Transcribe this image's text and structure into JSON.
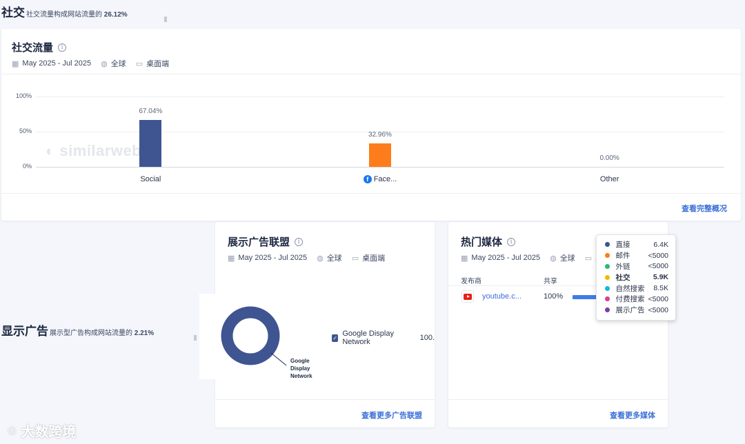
{
  "social_section": {
    "title": "社交",
    "subtitle_prefix": "社交流量构成网站流量的",
    "subtitle_value": "26.12%"
  },
  "social_card": {
    "title": "社交流量",
    "date_range": "May 2025 - Jul 2025",
    "region": "全球",
    "device": "桌面端",
    "watermark": "similarweb",
    "footer_link": "查看完整概况"
  },
  "chart_data": {
    "type": "bar",
    "categories": [
      "Social",
      "Face...",
      "Other"
    ],
    "values": [
      67.04,
      32.96,
      0.0
    ],
    "value_labels": [
      "67.04%",
      "32.96%",
      "0.00%"
    ],
    "colors": [
      "#3f5591",
      "#fd7d1c",
      "#3f5591"
    ],
    "y_ticks": [
      "100%",
      "50%",
      "0%"
    ],
    "ylim": [
      0,
      100
    ],
    "grid": true
  },
  "display_section": {
    "title": "显示广告",
    "subtitle_prefix": "展示型广告构成网站流量的",
    "subtitle_value": "2.21%"
  },
  "ad_card": {
    "title": "展示广告联盟",
    "date_range": "May 2025 - Jul 2025",
    "region": "全球",
    "device": "桌面端",
    "donut_label_lines": [
      "Google",
      "Display",
      "Network"
    ],
    "legend_name": "Google Display Network",
    "legend_value": "100.",
    "donut_color": "#3f5591",
    "share": 100,
    "footer_link": "查看更多广告联盟"
  },
  "media_card": {
    "title": "热门媒体",
    "date_range": "May 2025 - Jul 2025",
    "region": "全球",
    "device_partial": "桌",
    "col_publisher": "发布商",
    "col_share": "共享",
    "row_site": "youtube.c...",
    "row_share": "100%",
    "share_fraction": 0.45,
    "footer_link": "查看更多媒体"
  },
  "tooltip": {
    "items": [
      {
        "name": "直接",
        "value": "6.4K",
        "color": "#3f5591",
        "active": false
      },
      {
        "name": "邮件",
        "value": "<5000",
        "color": "#fd7d1c",
        "active": false
      },
      {
        "name": "外链",
        "value": "<5000",
        "color": "#2eb87a",
        "active": false
      },
      {
        "name": "社交",
        "value": "5.9K",
        "color": "#f5b800",
        "active": true
      },
      {
        "name": "自然搜索",
        "value": "8.5K",
        "color": "#19b7d6",
        "active": false
      },
      {
        "name": "付费搜索",
        "value": "<5000",
        "color": "#e03e8a",
        "active": false
      },
      {
        "name": "展示广告",
        "value": "<5000",
        "color": "#7b3fa8",
        "active": false
      }
    ]
  },
  "brand": {
    "name": "大数跨境",
    "icon": "logo-icon"
  }
}
